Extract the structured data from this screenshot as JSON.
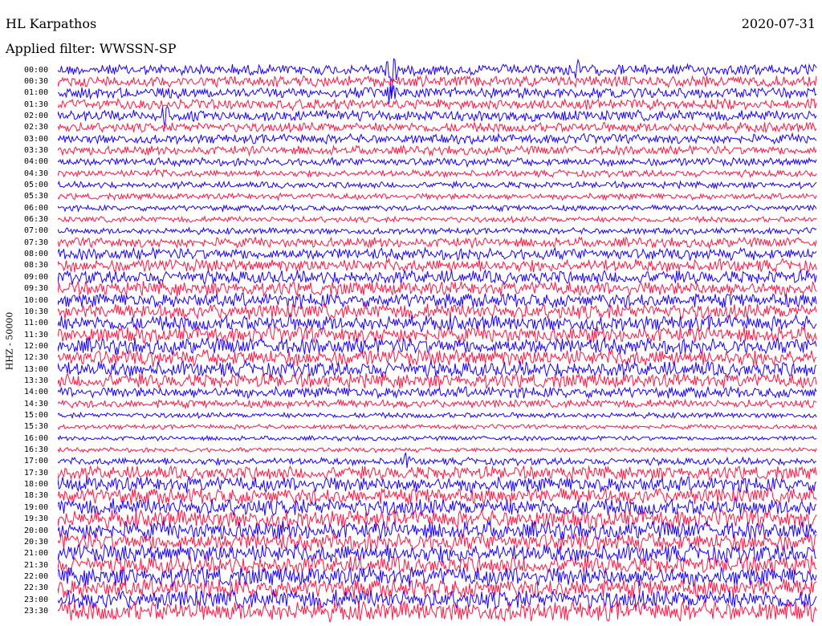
{
  "header": {
    "station": "HL Karpathos",
    "date": "2020-07-31",
    "filter": "Applied filter: WWSSN-SP"
  },
  "chart_data": {
    "type": "line",
    "title": "HL Karpathos",
    "ylabel": "HHZ - 50000",
    "colors": [
      "#1a00ff",
      "#ff1744"
    ],
    "rows": [
      {
        "time": "00:00",
        "amp": 0.6
      },
      {
        "time": "00:30",
        "amp": 0.62
      },
      {
        "time": "01:00",
        "amp": 0.6
      },
      {
        "time": "01:30",
        "amp": 0.58
      },
      {
        "time": "02:00",
        "amp": 0.6
      },
      {
        "time": "02:30",
        "amp": 0.55
      },
      {
        "time": "03:00",
        "amp": 0.52
      },
      {
        "time": "03:30",
        "amp": 0.5
      },
      {
        "time": "04:00",
        "amp": 0.45
      },
      {
        "time": "04:30",
        "amp": 0.38
      },
      {
        "time": "05:00",
        "amp": 0.36
      },
      {
        "time": "05:30",
        "amp": 0.34
      },
      {
        "time": "06:00",
        "amp": 0.32
      },
      {
        "time": "06:30",
        "amp": 0.32
      },
      {
        "time": "07:00",
        "amp": 0.34
      },
      {
        "time": "07:30",
        "amp": 0.55
      },
      {
        "time": "08:00",
        "amp": 0.65
      },
      {
        "time": "08:30",
        "amp": 0.7
      },
      {
        "time": "09:00",
        "amp": 0.75
      },
      {
        "time": "09:30",
        "amp": 0.78
      },
      {
        "time": "10:00",
        "amp": 0.8
      },
      {
        "time": "10:30",
        "amp": 0.85
      },
      {
        "time": "11:00",
        "amp": 0.85
      },
      {
        "time": "11:30",
        "amp": 0.88
      },
      {
        "time": "12:00",
        "amp": 0.9
      },
      {
        "time": "12:30",
        "amp": 0.9
      },
      {
        "time": "13:00",
        "amp": 0.85
      },
      {
        "time": "13:30",
        "amp": 0.8
      },
      {
        "time": "14:00",
        "amp": 0.6
      },
      {
        "time": "14:30",
        "amp": 0.45
      },
      {
        "time": "15:00",
        "amp": 0.3
      },
      {
        "time": "15:30",
        "amp": 0.25
      },
      {
        "time": "16:00",
        "amp": 0.25
      },
      {
        "time": "16:30",
        "amp": 0.25
      },
      {
        "time": "17:00",
        "amp": 0.4
      },
      {
        "time": "17:30",
        "amp": 0.75
      },
      {
        "time": "18:00",
        "amp": 0.85
      },
      {
        "time": "18:30",
        "amp": 0.9
      },
      {
        "time": "19:00",
        "amp": 0.95
      },
      {
        "time": "19:30",
        "amp": 1.0
      },
      {
        "time": "20:00",
        "amp": 1.0
      },
      {
        "time": "20:30",
        "amp": 1.0
      },
      {
        "time": "21:00",
        "amp": 1.0
      },
      {
        "time": "21:30",
        "amp": 1.0
      },
      {
        "time": "22:00",
        "amp": 1.05
      },
      {
        "time": "22:30",
        "amp": 1.05
      },
      {
        "time": "23:00",
        "amp": 1.05
      },
      {
        "time": "23:30",
        "amp": 1.1
      }
    ],
    "events": [
      {
        "row": 0,
        "x": 0.44,
        "size": 5.0
      },
      {
        "row": 0,
        "x": 0.68,
        "size": 2.0
      },
      {
        "row": 2,
        "x": 0.44,
        "size": 2.5
      },
      {
        "row": 4,
        "x": 0.14,
        "size": 2.0
      },
      {
        "row": 9,
        "x": 0.13,
        "size": 1.5
      },
      {
        "row": 34,
        "x": 0.46,
        "size": 1.5
      }
    ]
  }
}
